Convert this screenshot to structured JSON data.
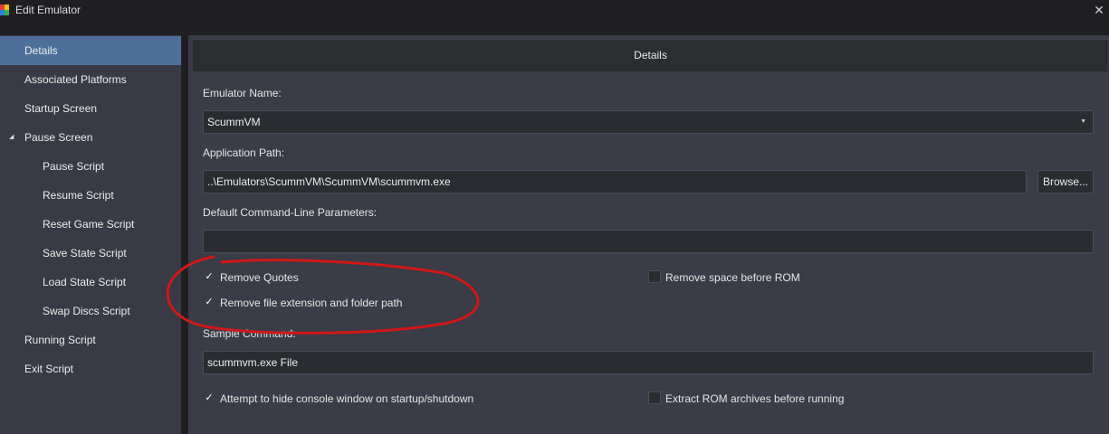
{
  "window": {
    "title": "Edit Emulator",
    "close_icon": "✕"
  },
  "sidebar": {
    "items": [
      {
        "label": "Details",
        "active": true
      },
      {
        "label": "Associated Platforms"
      },
      {
        "label": "Startup Screen"
      },
      {
        "label": "Pause Screen",
        "expanded": true
      },
      {
        "label": "Pause Script"
      },
      {
        "label": "Resume Script"
      },
      {
        "label": "Reset Game Script"
      },
      {
        "label": "Save State Script"
      },
      {
        "label": "Load State Script"
      },
      {
        "label": "Swap Discs Script"
      },
      {
        "label": "Running Script"
      },
      {
        "label": "Exit Script"
      }
    ]
  },
  "main": {
    "header": "Details",
    "emulator_name": {
      "label": "Emulator Name:",
      "value": "ScummVM"
    },
    "application_path": {
      "label": "Application Path:",
      "value": "..\\Emulators\\ScummVM\\ScummVM\\scummvm.exe",
      "browse_label": "Browse..."
    },
    "command_line": {
      "label": "Default Command-Line Parameters:",
      "value": ""
    },
    "checkboxes": {
      "remove_quotes": {
        "label": "Remove Quotes",
        "checked": true
      },
      "remove_space": {
        "label": "Remove space before ROM",
        "checked": false
      },
      "remove_extension": {
        "label": "Remove file extension and folder path",
        "checked": true
      },
      "hide_console": {
        "label": "Attempt to hide console window on startup/shutdown",
        "checked": true
      },
      "extract_rom": {
        "label": "Extract ROM archives before running",
        "checked": false
      }
    },
    "sample_command": {
      "label": "Sample Command:",
      "value": "scummvm.exe File"
    }
  },
  "colors": {
    "accent": "#4e6f99",
    "annotation": "#d01818"
  }
}
